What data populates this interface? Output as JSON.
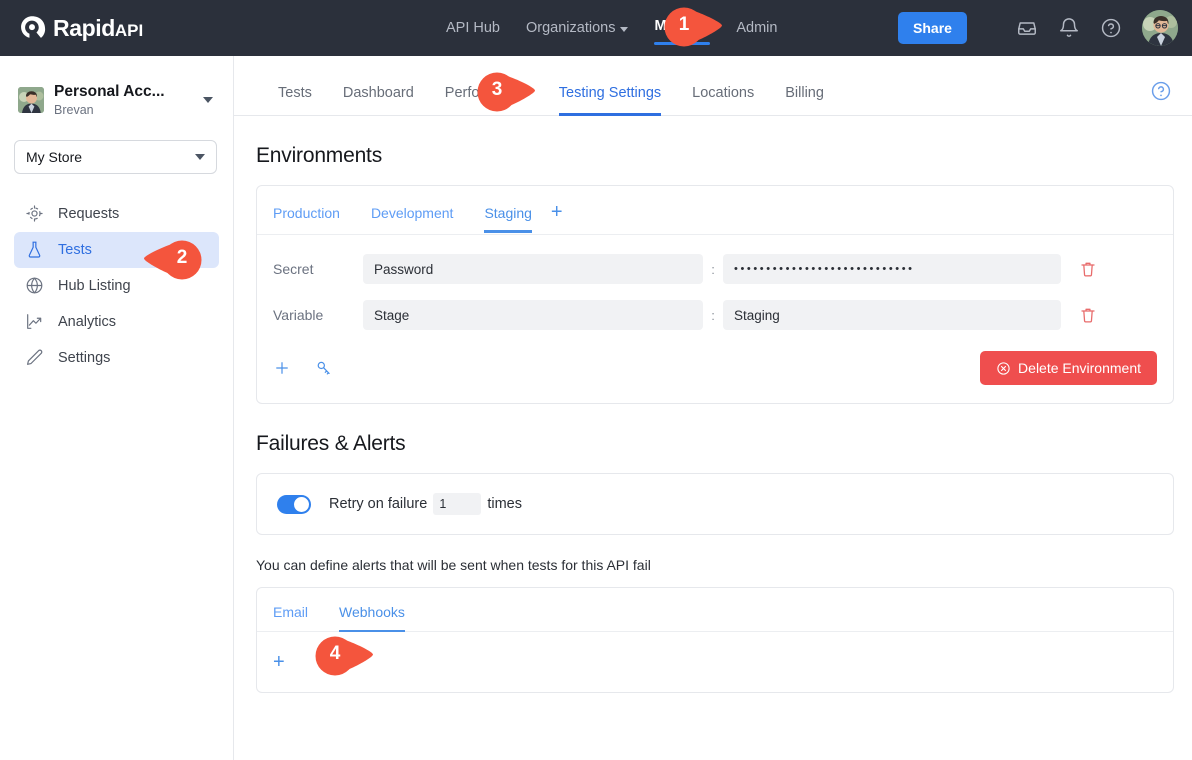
{
  "brand": {
    "name": "Rapid",
    "suffix": "API",
    "accent": "#2f80ed",
    "topbar_bg": "#2b303b",
    "danger": "#ef4e4e",
    "marker_color": "#f4553d"
  },
  "topnav": {
    "items": [
      {
        "label": "API Hub",
        "active": false,
        "has_caret": false
      },
      {
        "label": "Organizations",
        "active": false,
        "has_caret": true
      },
      {
        "label": "My APIs",
        "active": true,
        "has_caret": false
      },
      {
        "label": "Admin",
        "active": false,
        "has_caret": false
      }
    ],
    "share_label": "Share",
    "icons": [
      "inbox-icon",
      "bell-icon",
      "help-icon"
    ],
    "avatar": "user-avatar"
  },
  "sidebar": {
    "account": {
      "name": "Personal Acc...",
      "subtitle": "Brevan",
      "avatar": "account-avatar"
    },
    "store_select": {
      "value": "My Store"
    },
    "items": [
      {
        "label": "Requests",
        "icon": "target-icon",
        "active": false
      },
      {
        "label": "Tests",
        "icon": "flask-icon",
        "active": true
      },
      {
        "label": "Hub Listing",
        "icon": "globe-icon",
        "active": false
      },
      {
        "label": "Analytics",
        "icon": "chart-up-icon",
        "active": false
      },
      {
        "label": "Settings",
        "icon": "pencil-icon",
        "active": false
      }
    ]
  },
  "main": {
    "tabs": [
      {
        "label": "Tests",
        "active": false
      },
      {
        "label": "Dashboard",
        "active": false
      },
      {
        "label": "Performance",
        "active": false
      },
      {
        "label": "Testing Settings",
        "active": true
      },
      {
        "label": "Locations",
        "active": false
      },
      {
        "label": "Billing",
        "active": false
      }
    ],
    "help_icon": "help-circle-icon"
  },
  "environments": {
    "title": "Environments",
    "tabs": [
      {
        "label": "Production",
        "active": false
      },
      {
        "label": "Development",
        "active": false
      },
      {
        "label": "Staging",
        "active": true
      }
    ],
    "add_tab_label": "+",
    "rows": [
      {
        "type_label": "Secret",
        "key": "Password",
        "separator": ":",
        "value": "••••••••••••••••••••••••••••",
        "masked": true,
        "delete_icon": "trash-icon"
      },
      {
        "type_label": "Variable",
        "key": "Stage",
        "separator": ":",
        "value": "Staging",
        "masked": false,
        "delete_icon": "trash-icon"
      }
    ],
    "footer": {
      "add_icon": "plus-icon",
      "secret_icon": "key-icon",
      "delete_button": {
        "label": "Delete Environment",
        "icon": "cancel-circle-icon"
      }
    }
  },
  "failures": {
    "title": "Failures & Alerts",
    "retry": {
      "enabled": true,
      "label_before": "Retry on failure",
      "value": "1",
      "label_after": "times"
    },
    "alerts_note": "You can define alerts that will be sent when tests for this API fail",
    "alert_tabs": [
      {
        "label": "Email",
        "active": false
      },
      {
        "label": "Webhooks",
        "active": true
      }
    ],
    "add_alert_label": "+"
  },
  "markers": [
    {
      "number": "1",
      "direction": "right"
    },
    {
      "number": "2",
      "direction": "left"
    },
    {
      "number": "3",
      "direction": "right"
    },
    {
      "number": "4",
      "direction": "right"
    }
  ]
}
